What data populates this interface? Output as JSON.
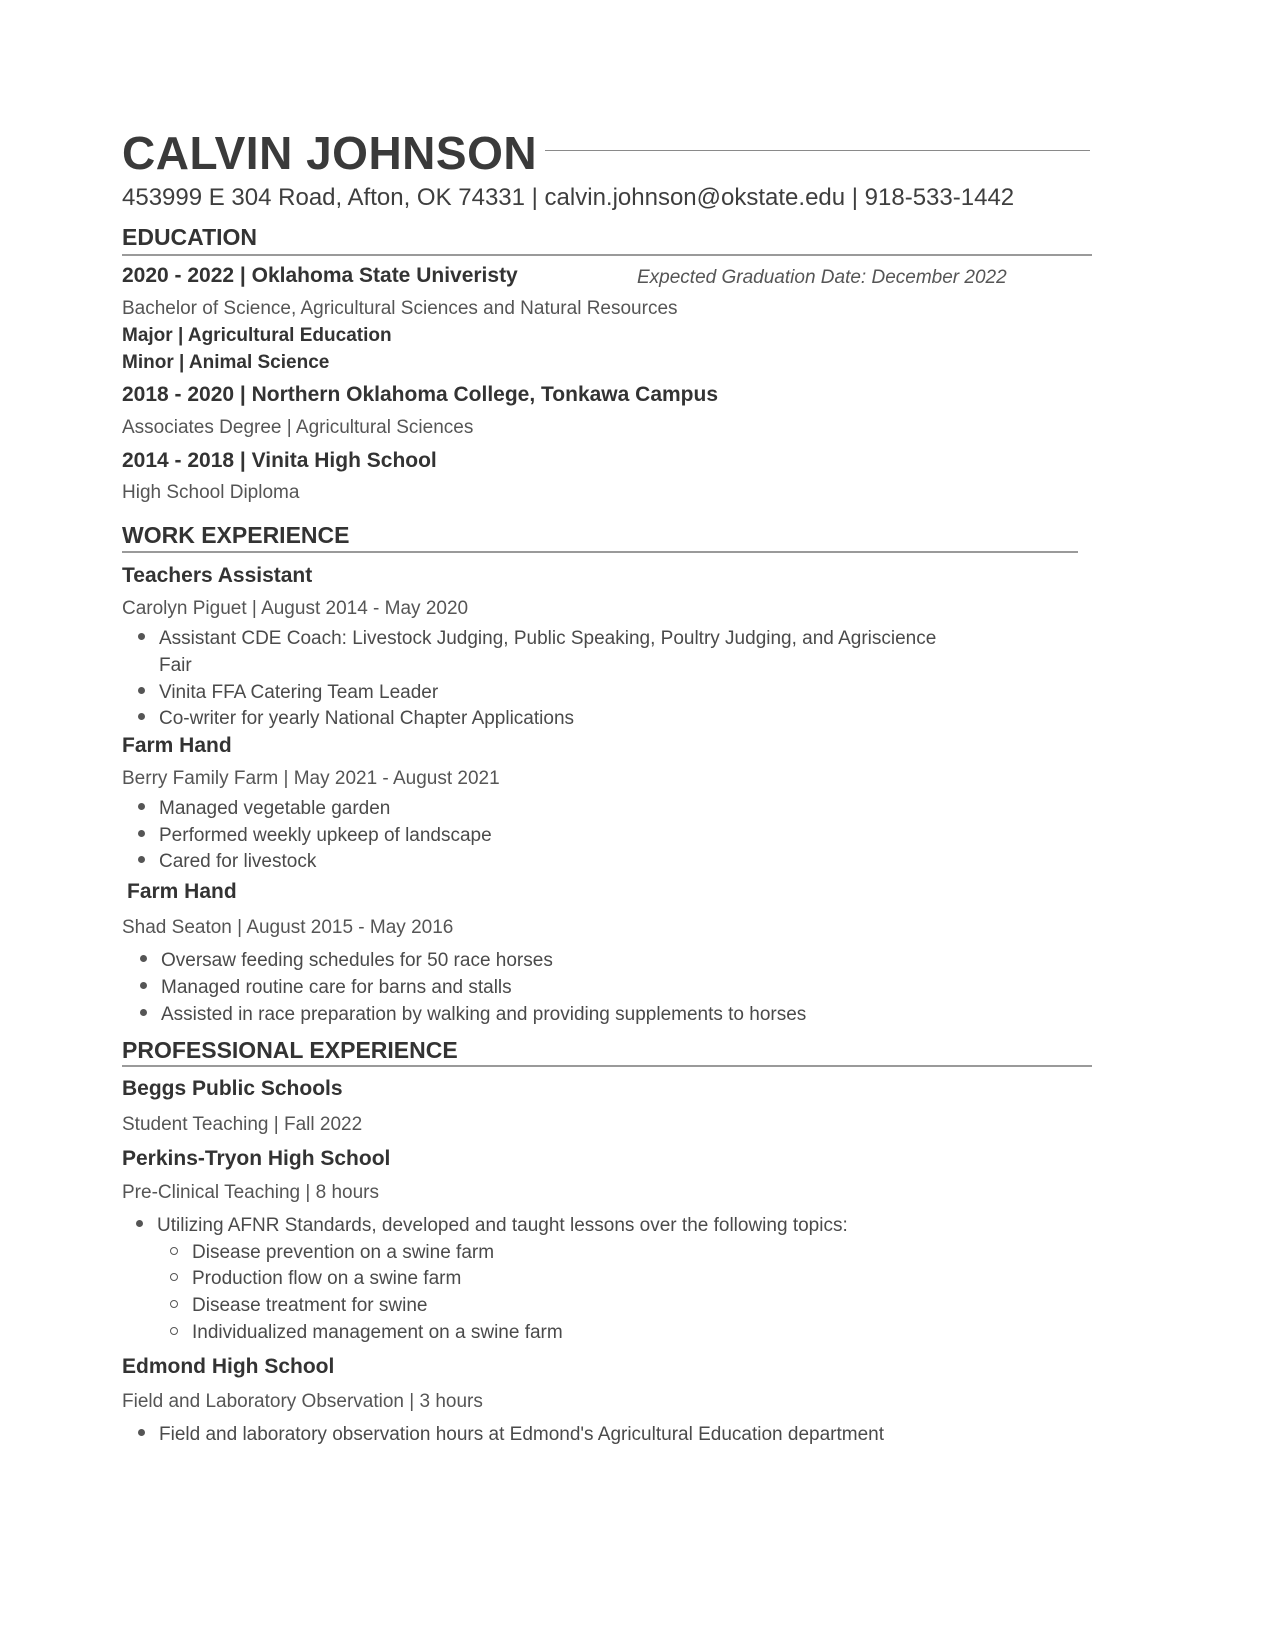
{
  "header": {
    "name": "CALVIN JOHNSON",
    "contact": "453999 E 304 Road, Afton, OK 74331 | calvin.johnson@okstate.edu | 918-533-1442"
  },
  "education": {
    "title": "EDUCATION",
    "entries": [
      {
        "heading": "2020 - 2022 | Oklahoma State Univeristy",
        "note": "Expected Graduation Date: December 2022",
        "degree": "Bachelor of Science, Agricultural Sciences and Natural Resources",
        "major": "Major | Agricultural Education",
        "minor": "Minor | Animal Science"
      },
      {
        "heading": "2018 - 2020  | Northern Oklahoma College, Tonkawa  Campus",
        "degree": "Associates Degree | Agricultural Sciences"
      },
      {
        "heading": "2014 - 2018  | Vinita High School",
        "degree": "High School Diploma"
      }
    ]
  },
  "work": {
    "title": "WORK EXPERIENCE",
    "jobs": [
      {
        "role": "Teachers Assistant",
        "meta": "Carolyn Piguet |  August 2014 - May 2020",
        "bullets": [
          "Assistant CDE Coach: Livestock Judging, Public Speaking, Poultry Judging, and Agriscience",
          "Fair",
          "Vinita FFA Catering Team Leader",
          "Co-writer for yearly National Chapter Applications"
        ]
      },
      {
        "role": "Farm Hand",
        "meta": "Berry Family Farm | May 2021 - August 2021",
        "bullets": [
          "Managed vegetable garden",
          "Performed weekly upkeep of landscape",
          "Cared for livestock"
        ]
      },
      {
        "role": "Farm Hand",
        "meta": "Shad Seaton | August 2015 - May 2016",
        "bullets": [
          "Oversaw feeding schedules for 50 race horses",
          "Managed routine care for barns and stalls",
          "Assisted in race preparation by walking and providing supplements to horses"
        ]
      }
    ]
  },
  "professional": {
    "title": "PROFESSIONAL EXPERIENCE",
    "entries": [
      {
        "org": "Beggs Public Schools",
        "meta": "Student Teaching | Fall 2022"
      },
      {
        "org": "Perkins-Tryon High School",
        "meta": "Pre-Clinical Teaching | 8 hours",
        "bullet": "Utilizing AFNR Standards, developed and taught lessons over the following topics:",
        "subbullets": [
          "Disease prevention on a swine farm",
          "Production flow on a swine farm",
          "Disease treatment for swine",
          "Individualized management on a swine farm"
        ]
      },
      {
        "org": "Edmond High School",
        "meta": "Field and Laboratory Observation | 3 hours",
        "bullet": "Field and laboratory observation hours at Edmond's Agricultural Education department"
      }
    ]
  }
}
